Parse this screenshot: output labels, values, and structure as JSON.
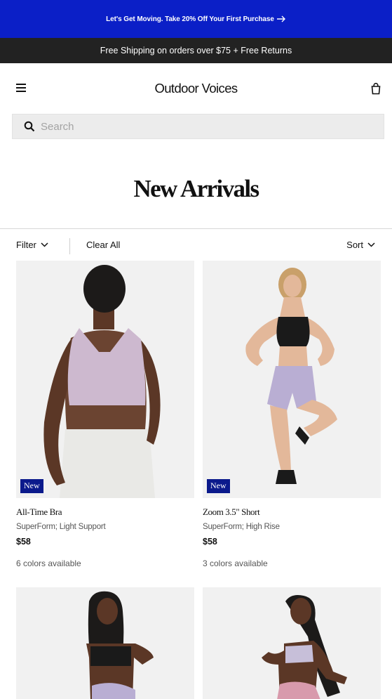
{
  "promo": {
    "text": "Let's Get Moving. Take 20% Off Your First Purchase"
  },
  "shipping": {
    "text": "Free Shipping on orders over $75 + Free Returns"
  },
  "header": {
    "logo": "Outdoor Voices"
  },
  "search": {
    "placeholder": "Search",
    "value": ""
  },
  "page": {
    "title": "New Arrivals"
  },
  "toolbar": {
    "filter_label": "Filter",
    "clear_label": "Clear All",
    "sort_label": "Sort"
  },
  "products": [
    {
      "badge": "New",
      "name": "All-Time Bra",
      "subtitle": "SuperForm; Light Support",
      "price": "$58",
      "colors": "6 colors available"
    },
    {
      "badge": "New",
      "name": "Zoom 3.5\" Short",
      "subtitle": "SuperForm; High Rise",
      "price": "$58",
      "colors": "3 colors available"
    },
    {},
    {}
  ],
  "colors": {
    "promo_bg": "#0b1fc7",
    "ship_bg": "#222222",
    "badge_bg": "#0b1a8c",
    "image_bg": "#f1f1f1"
  }
}
